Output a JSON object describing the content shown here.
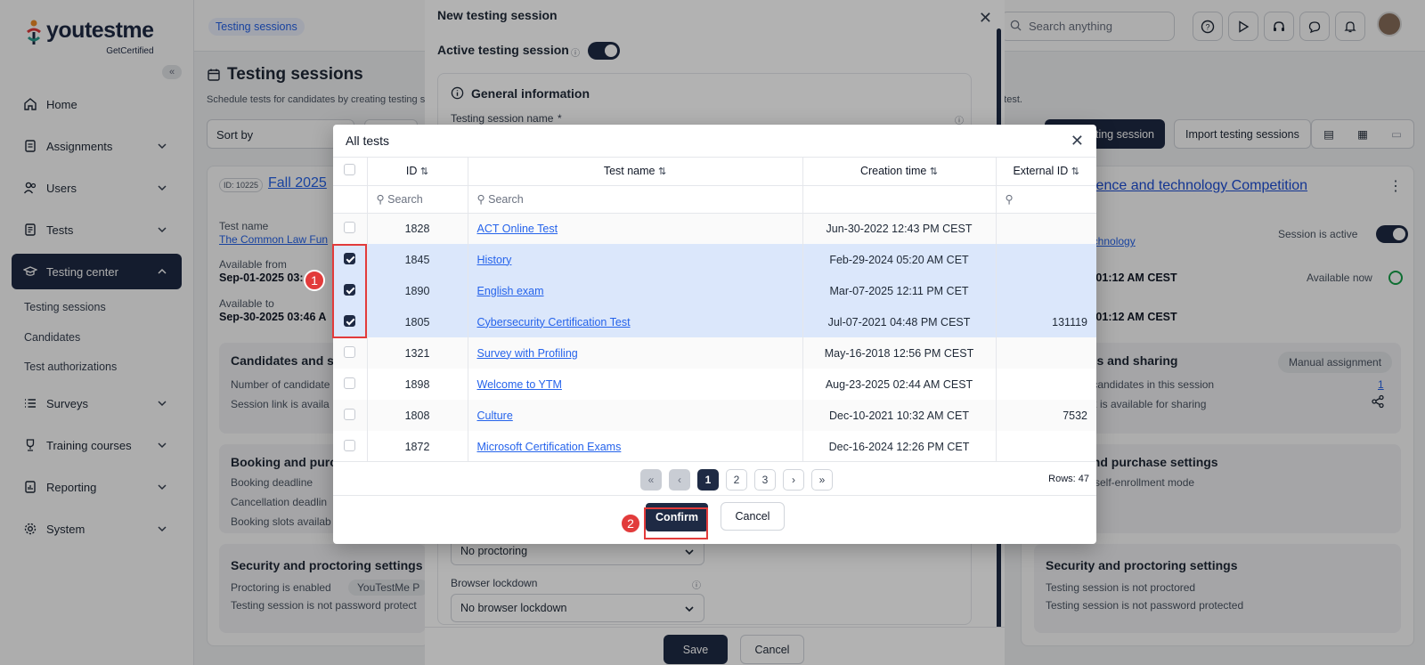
{
  "sidebar": {
    "logo": "youtestme",
    "logo_sub": "GetCertified",
    "items": [
      {
        "label": "Home"
      },
      {
        "label": "Assignments"
      },
      {
        "label": "Users"
      },
      {
        "label": "Tests"
      },
      {
        "label": "Testing center"
      },
      {
        "label": "Surveys"
      },
      {
        "label": "Training courses"
      },
      {
        "label": "Reporting"
      },
      {
        "label": "System"
      }
    ],
    "subitems": [
      "Testing sessions",
      "Candidates",
      "Test authorizations"
    ]
  },
  "topbar": {
    "breadcrumb": "Testing sessions",
    "search_placeholder": "Search anything"
  },
  "page": {
    "title": "Testing sessions",
    "description": "Schedule tests for candidates by creating testing se",
    "description_tail": "a test.",
    "sort_by": "Sort by",
    "new_session_btn": "ting session",
    "import_btn": "Import testing sessions"
  },
  "left_card": {
    "id_badge": "ID: 10225",
    "title": "Fall 2025",
    "test_name_label": "Test name",
    "test_name_value": "The Common Law Fun",
    "available_from_label": "Available from",
    "available_from_value": "Sep-01-2025 03:",
    "available_to_label": "Available to",
    "available_to_value": "Sep-30-2025 03:46 A",
    "candidates_title": "Candidates and s",
    "candidates_line1": "Number of candidate",
    "candidates_line2": "Session link is availa",
    "booking_title": "Booking and purc",
    "booking_line1": "Booking deadline",
    "booking_line2": "Cancellation deadlin",
    "booking_line3": "Booking slots availab",
    "security_title": "Security and proctoring settings",
    "security_line1": "Proctoring is enabled",
    "security_chip": "YouTestMe P",
    "security_line2": "Testing session is not password protect"
  },
  "right_card": {
    "title": "cience and technology Competition",
    "test_link": "echnology",
    "session_active_label": "Session is active",
    "from_label": "m",
    "from_value": "5 01:12 AM CEST",
    "available_now": "Available now",
    "to_value": "5 01:12 AM CEST",
    "candidates_title": "tes and sharing",
    "manual_assignment": "Manual assignment",
    "candidates_line1": "r candidates in this session",
    "candidates_count": "1",
    "candidates_line2": "nk is available for sharing",
    "booking_title": "and purchase settings",
    "booking_line1": "n self-enrollment mode",
    "security_title": "Security and proctoring settings",
    "security_line1": "Testing session is not proctored",
    "security_line2": "Testing session is not password protected"
  },
  "new_session_modal": {
    "title": "New testing session",
    "active_label": "Active testing session",
    "general_info": "General information",
    "session_name_label": "Testing session name",
    "required_mark": "*",
    "proctoring_value": "No proctoring",
    "browser_lockdown_label": "Browser lockdown",
    "browser_lockdown_value": "No browser lockdown",
    "save": "Save",
    "cancel": "Cancel"
  },
  "all_tests_modal": {
    "title": "All tests",
    "columns": {
      "id": "ID",
      "name": "Test name",
      "time": "Creation time",
      "ext": "External ID"
    },
    "search_placeholder": "Search",
    "rows": [
      {
        "id": "1828",
        "name": "ACT Online Test",
        "time": "Jun-30-2022 12:43 PM CEST",
        "ext": "",
        "checked": false
      },
      {
        "id": "1845",
        "name": "History",
        "time": "Feb-29-2024 05:20 AM CET",
        "ext": "",
        "checked": true
      },
      {
        "id": "1890",
        "name": "English exam",
        "time": "Mar-07-2025 12:11 PM CET",
        "ext": "",
        "checked": true
      },
      {
        "id": "1805",
        "name": "Cybersecurity Certification Test",
        "time": "Jul-07-2021 04:48 PM CEST",
        "ext": "131119",
        "checked": true
      },
      {
        "id": "1321",
        "name": "Survey with Profiling",
        "time": "May-16-2018 12:56 PM CEST",
        "ext": "",
        "checked": false
      },
      {
        "id": "1898",
        "name": "Welcome to YTM",
        "time": "Aug-23-2025 02:44 AM CEST",
        "ext": "",
        "checked": false
      },
      {
        "id": "1808",
        "name": "Culture",
        "time": "Dec-10-2021 10:32 AM CET",
        "ext": "7532",
        "checked": false
      },
      {
        "id": "1872",
        "name": "Microsoft Certification Exams",
        "time": "Dec-16-2024 12:26 PM CET",
        "ext": "",
        "checked": false
      }
    ],
    "pages": [
      "1",
      "2",
      "3"
    ],
    "rows_label": "Rows: 47",
    "confirm": "Confirm",
    "cancel": "Cancel"
  },
  "annotations": {
    "step1": "1",
    "step2": "2"
  },
  "colors": {
    "primary": "#1e2a44",
    "link": "#2563eb",
    "highlight": "#e23b3b",
    "selected_row": "#dbe7fb"
  }
}
